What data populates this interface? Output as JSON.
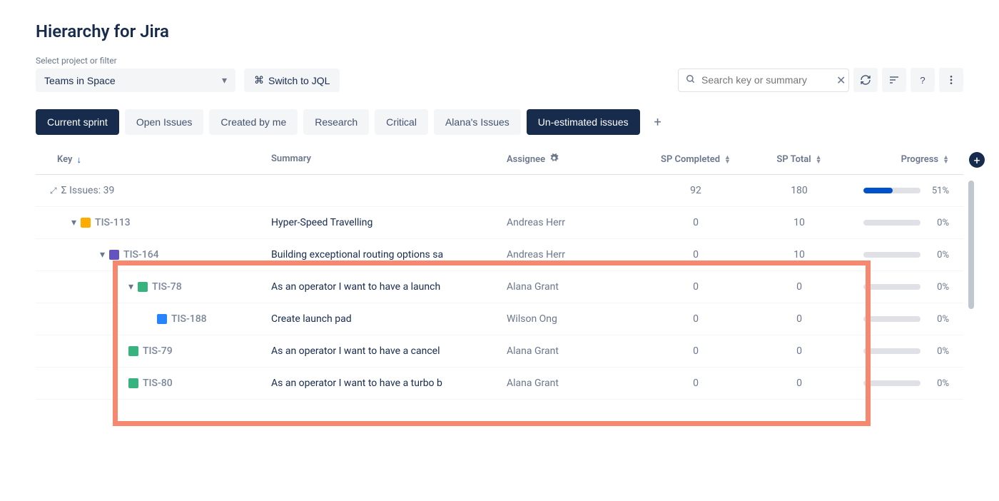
{
  "title": "Hierarchy for Jira",
  "projectSelect": {
    "label": "Select project or filter",
    "value": "Teams in Space"
  },
  "jqlButton": "Switch to JQL",
  "search": {
    "placeholder": "Search key or summary"
  },
  "filterTabs": [
    {
      "label": "Current sprint",
      "active": true
    },
    {
      "label": "Open Issues",
      "active": false
    },
    {
      "label": "Created by me",
      "active": false
    },
    {
      "label": "Research",
      "active": false
    },
    {
      "label": "Critical",
      "active": false
    },
    {
      "label": "Alana's Issues",
      "active": false
    },
    {
      "label": "Un-estimated issues",
      "active": true
    }
  ],
  "columns": {
    "key": "Key",
    "summary": "Summary",
    "assignee": "Assignee",
    "spCompleted": "SP Completed",
    "spTotal": "SP Total",
    "progress": "Progress"
  },
  "summaryRow": {
    "label": "Σ Issues: 39",
    "spCompleted": "92",
    "spTotal": "180",
    "progressPct": "51%",
    "progressFill": 51
  },
  "rows": [
    {
      "key": "TIS-113",
      "summary": "Hyper-Speed Travelling",
      "assignee": "Andreas Herr",
      "spc": "0",
      "spt": "10",
      "pct": "0%",
      "fill": 0,
      "indent": 1,
      "icon": "summary",
      "expandable": true
    },
    {
      "key": "TIS-164",
      "summary": "Building exceptional routing options sa",
      "assignee": "Andreas Herr",
      "spc": "0",
      "spt": "10",
      "pct": "0%",
      "fill": 0,
      "indent": 2,
      "icon": "epic",
      "expandable": true
    },
    {
      "key": "TIS-78",
      "summary": "As an operator I want to have a launch",
      "assignee": "Alana Grant",
      "spc": "0",
      "spt": "0",
      "pct": "0%",
      "fill": 0,
      "indent": 3,
      "icon": "story",
      "expandable": true
    },
    {
      "key": "TIS-188",
      "summary": "Create launch pad",
      "assignee": "Wilson Ong",
      "spc": "0",
      "spt": "0",
      "pct": "0%",
      "fill": 0,
      "indent": 4,
      "icon": "task",
      "expandable": false
    },
    {
      "key": "TIS-79",
      "summary": "As an operator I want to have a cancel",
      "assignee": "Alana Grant",
      "spc": "0",
      "spt": "0",
      "pct": "0%",
      "fill": 0,
      "indent": 3,
      "icon": "story",
      "expandable": false
    },
    {
      "key": "TIS-80",
      "summary": "As an operator I want to have a turbo b",
      "assignee": "Alana Grant",
      "spc": "0",
      "spt": "0",
      "pct": "0%",
      "fill": 0,
      "indent": 3,
      "icon": "story",
      "expandable": false
    }
  ]
}
